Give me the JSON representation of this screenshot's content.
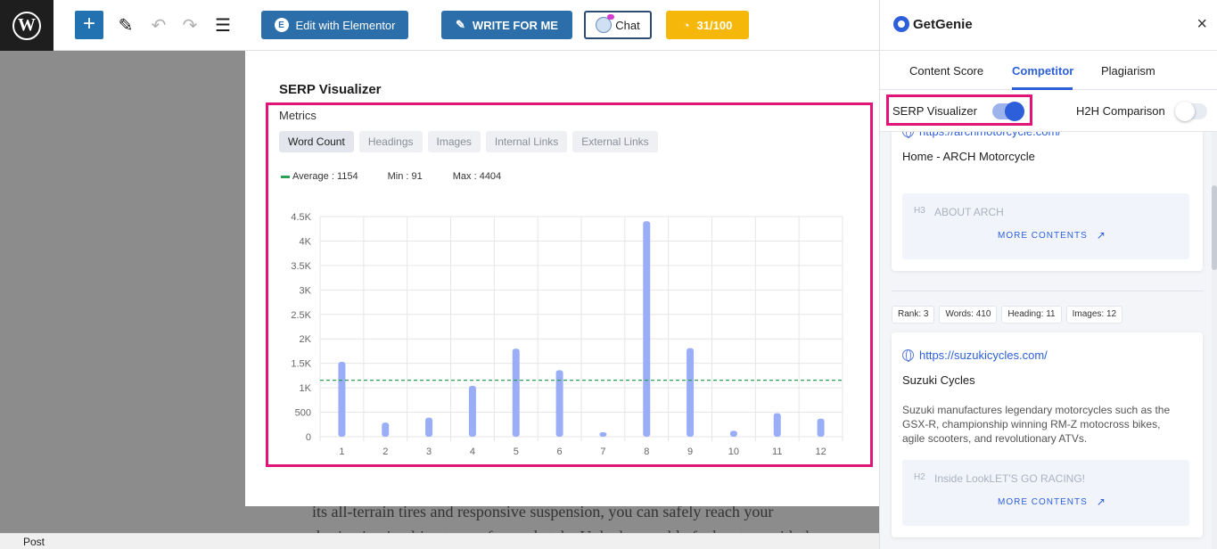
{
  "toolbar": {
    "wp_logo": "W",
    "add_icon": "+",
    "edit_elementor_label": "Edit with Elementor",
    "write_for_me_label": "WRITE FOR ME",
    "chat_label": "Chat",
    "score_label": "31/100"
  },
  "serp": {
    "title": "SERP Visualizer",
    "metrics_label": "Metrics",
    "metric_tabs": [
      {
        "label": "Word Count",
        "active": true
      },
      {
        "label": "Headings",
        "active": false
      },
      {
        "label": "Images",
        "active": false
      },
      {
        "label": "Internal Links",
        "active": false
      },
      {
        "label": "External Links",
        "active": false
      }
    ],
    "average_label": "Average : 1154",
    "min_label": "Min : 91",
    "max_label": "Max : 4404"
  },
  "chart_data": {
    "type": "bar",
    "categories": [
      "1",
      "2",
      "3",
      "4",
      "5",
      "6",
      "7",
      "8",
      "9",
      "10",
      "11",
      "12"
    ],
    "values": [
      1530,
      290,
      390,
      1040,
      1800,
      1360,
      91,
      4404,
      1810,
      120,
      480,
      370
    ],
    "average": 1154,
    "ylim": [
      0,
      4500
    ],
    "yticks": [
      "0",
      "500",
      "1K",
      "1.5K",
      "2K",
      "2.5K",
      "3K",
      "3.5K",
      "4K",
      "4.5K"
    ],
    "ytick_values": [
      0,
      500,
      1000,
      1500,
      2000,
      2500,
      3000,
      3500,
      4000,
      4500
    ],
    "title": "",
    "xlabel": "",
    "ylabel": "",
    "grid": true,
    "bar_color": "#99aef7",
    "average_line_color": "#2aa156"
  },
  "editor": {
    "line1": "its all-terrain tires and responsive suspension, you can safely reach your",
    "line2": "destination in ultimate comfort and style. Unlock a world of adventure with the",
    "status": "Post"
  },
  "panel": {
    "brand": "GetGenie",
    "close": "×",
    "tabs": [
      {
        "label": "Content Score",
        "active": false
      },
      {
        "label": "Competitor",
        "active": true
      },
      {
        "label": "Plagiarism",
        "active": false
      }
    ],
    "serp_toggle_label": "SERP Visualizer",
    "h2h_toggle_label": "H2H Comparison",
    "card1": {
      "url": "https://archmotorcycle.com/",
      "title": "Home - ARCH Motorcycle",
      "heading_tag": "H3",
      "heading_text": "ABOUT ARCH",
      "more": "MORE CONTENTS"
    },
    "chips": [
      "Rank: 3",
      "Words: 410",
      "Heading: 11",
      "Images: 12"
    ],
    "card2": {
      "url": "https://suzukicycles.com/",
      "title": "Suzuki Cycles",
      "description": "Suzuki manufactures legendary motorcycles such as the GSX-R, championship winning RM-Z motocross bikes, agile scooters, and revolutionary ATVs.",
      "heading_tag": "H2",
      "heading_text": "Inside LookLET'S GO RACING!",
      "more": "MORE CONTENTS"
    },
    "accent": "#2c5fd9"
  }
}
